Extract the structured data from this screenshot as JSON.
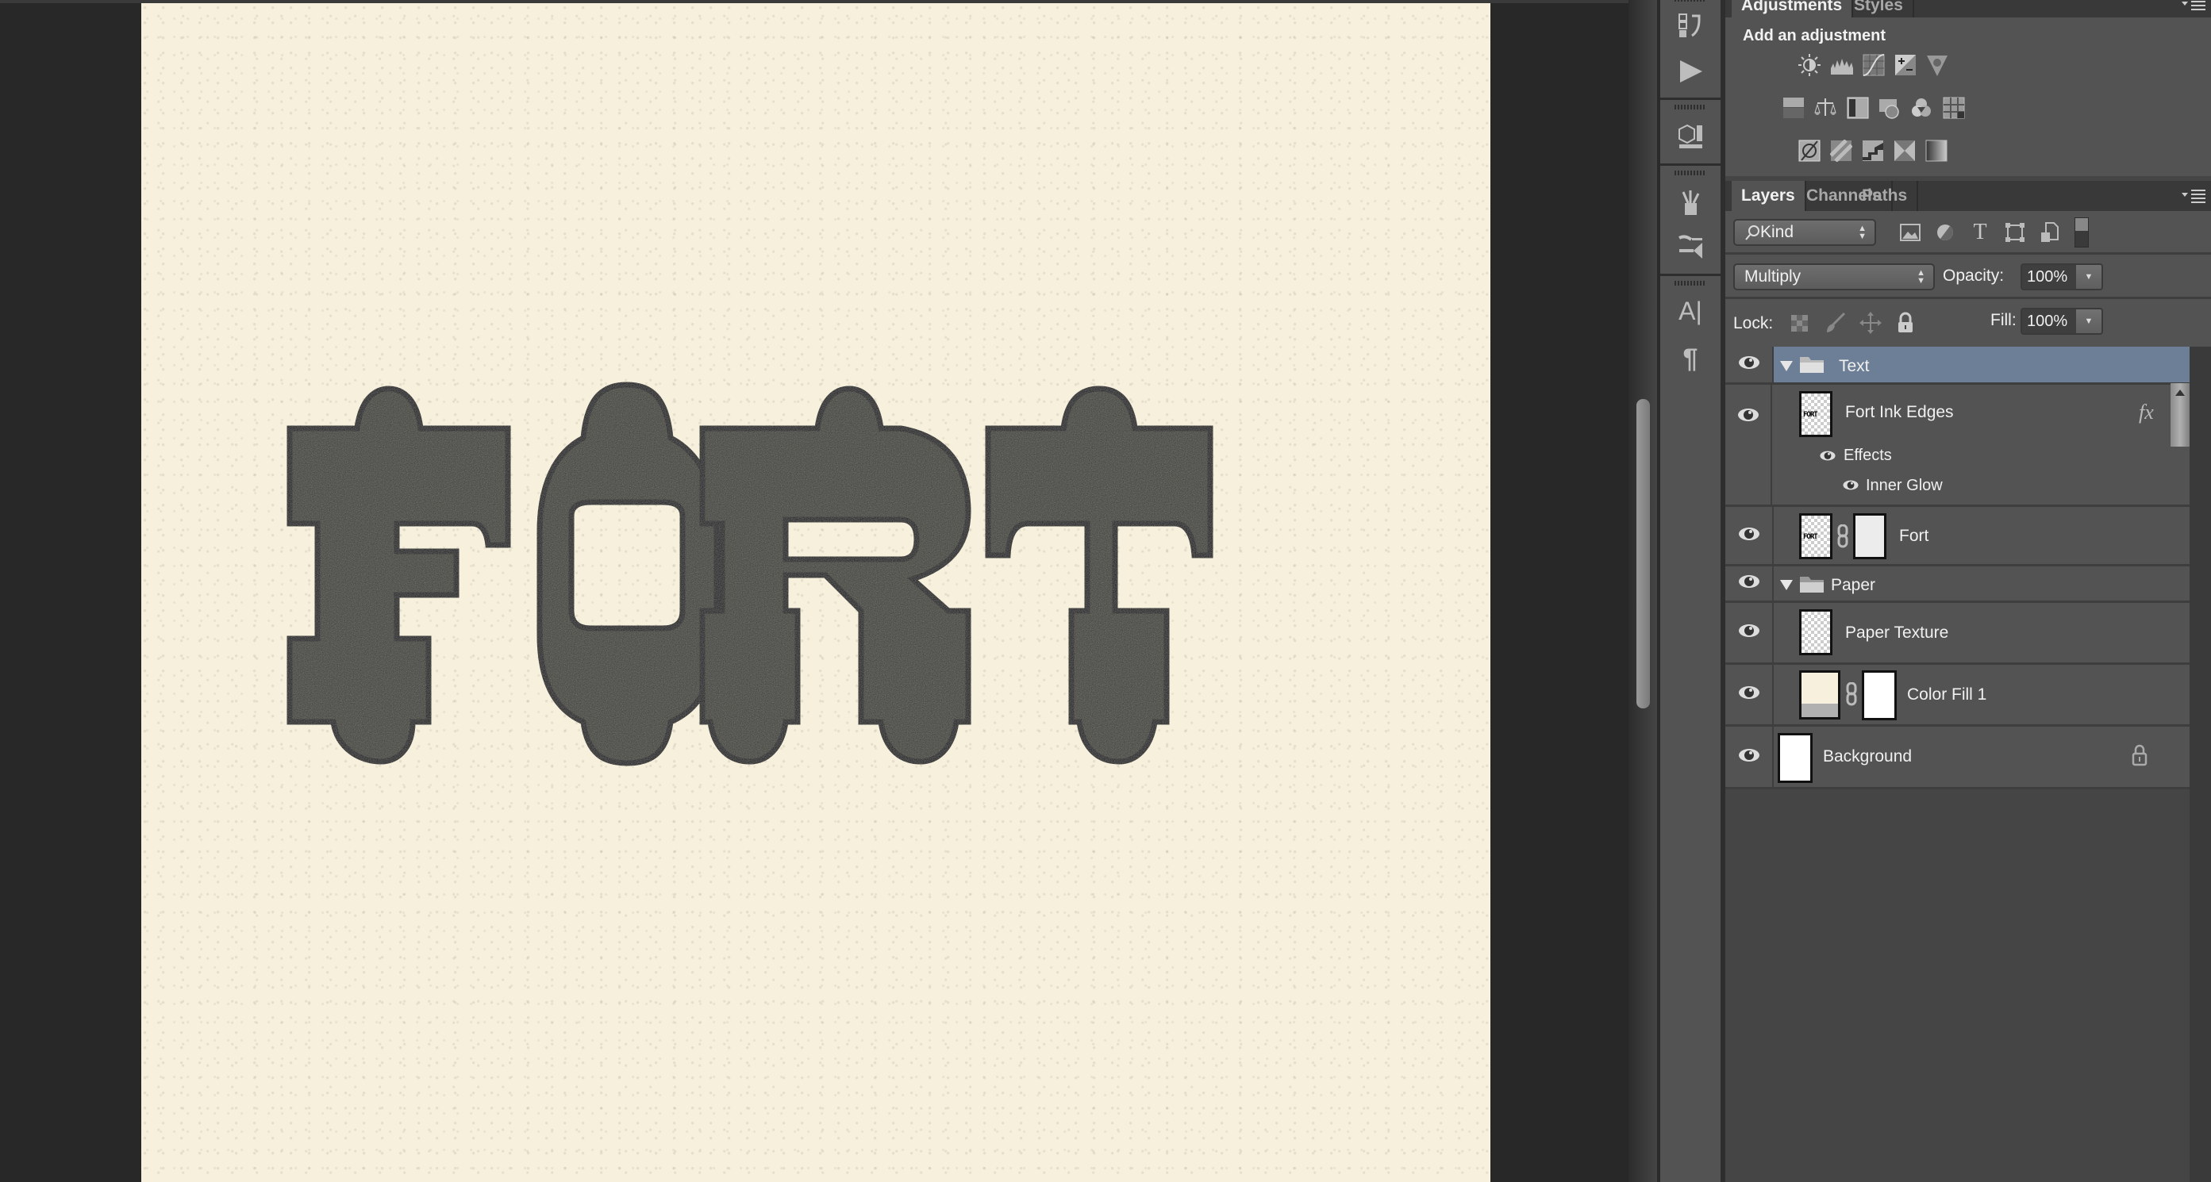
{
  "canvas": {
    "artwork_text": "FORT",
    "paper_color": "#f6f0dc",
    "ink_color": "#3b3a35"
  },
  "dock": {
    "buttons": [
      {
        "name": "history-icon"
      },
      {
        "name": "actions-play-icon"
      },
      {
        "name": "3d-icon"
      },
      {
        "name": "brush-presets-icon"
      },
      {
        "name": "brush-icon"
      },
      {
        "name": "character-icon",
        "glyph": "A|"
      },
      {
        "name": "paragraph-icon",
        "glyph": "¶"
      }
    ]
  },
  "adjustments_panel": {
    "tabs": [
      {
        "label": "Adjustments",
        "active": true
      },
      {
        "label": "Styles",
        "active": false
      }
    ],
    "title": "Add an adjustment",
    "rows": [
      [
        "brightness-contrast",
        "levels",
        "curves",
        "exposure",
        "vibrance"
      ],
      [
        "hue-saturation",
        "color-balance",
        "black-white",
        "photo-filter",
        "channel-mixer",
        "color-lookup"
      ],
      [
        "invert",
        "posterize",
        "threshold",
        "selective-color",
        "gradient-map"
      ]
    ]
  },
  "layers_panel": {
    "tabs": [
      {
        "label": "Layers",
        "active": true
      },
      {
        "label": "Channels",
        "active": false
      },
      {
        "label": "Paths",
        "active": false
      }
    ],
    "filter": {
      "label": "Kind",
      "icons": [
        "pixel-filter",
        "adjustment-filter",
        "type-filter",
        "shape-filter",
        "smart-object-filter"
      ]
    },
    "blend_mode": "Multiply",
    "opacity_label": "Opacity:",
    "opacity_value": "100%",
    "lock_label": "Lock:",
    "fill_label": "Fill:",
    "fill_value": "100%",
    "layers": [
      {
        "name": "Text",
        "type": "group",
        "expanded": true,
        "visible": true,
        "selected": true
      },
      {
        "name": "Fort Ink Edges",
        "type": "pixel",
        "visible": true,
        "thumb_text": "FORT",
        "fx": "fx",
        "effects_label": "Effects",
        "effects": [
          "Inner Glow"
        ]
      },
      {
        "name": "Fort",
        "type": "pixel-with-mask",
        "visible": true,
        "thumb_text": "FORT"
      },
      {
        "name": "Paper",
        "type": "group",
        "expanded": true,
        "visible": true
      },
      {
        "name": "Paper Texture",
        "type": "pixel",
        "visible": true
      },
      {
        "name": "Color Fill 1",
        "type": "fill",
        "visible": true,
        "fill_color": "#f6f0dc"
      },
      {
        "name": "Background",
        "type": "background",
        "visible": true,
        "locked": true
      }
    ]
  }
}
